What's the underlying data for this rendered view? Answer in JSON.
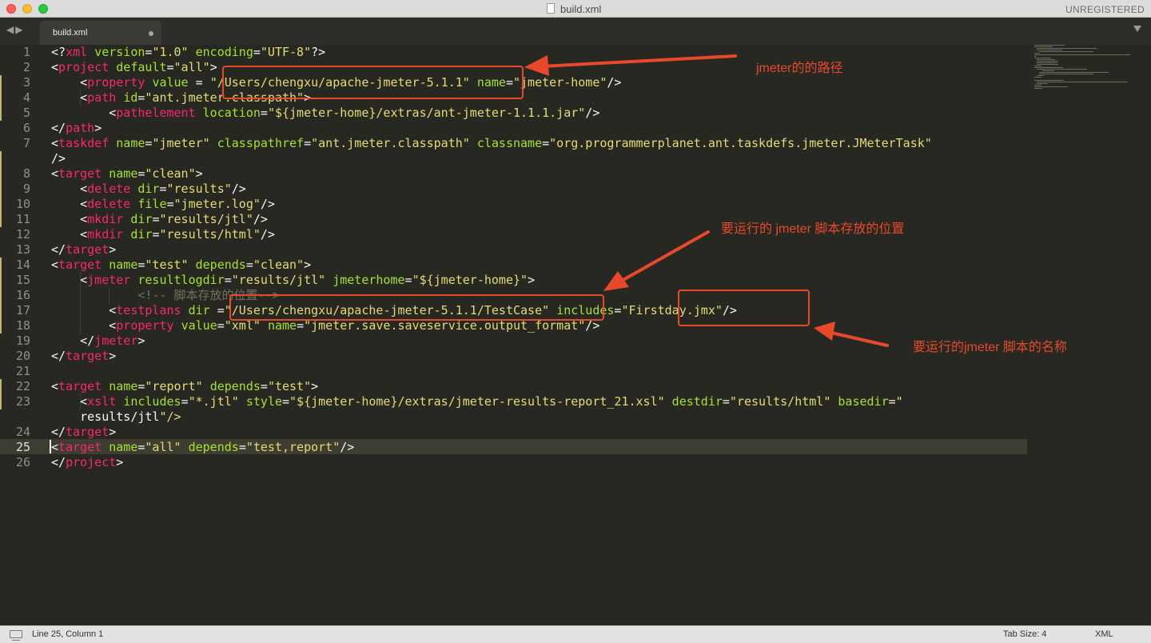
{
  "window": {
    "title": "build.xml",
    "registration": "UNREGISTERED"
  },
  "tabs": [
    {
      "label": "build.xml",
      "modified": true
    }
  ],
  "editor": {
    "line_numbers": [
      "1",
      "2",
      "3",
      "4",
      "5",
      "6",
      "7",
      "",
      "8",
      "9",
      "10",
      "11",
      "12",
      "13",
      "14",
      "15",
      "16",
      "17",
      "18",
      "19",
      "20",
      "21",
      "22",
      "23",
      "",
      "24",
      "25",
      "26"
    ],
    "current_line": "25",
    "lines": [
      "<?xml version=\"1.0\" encoding=\"UTF-8\"?>",
      "<project default=\"all\">",
      "    <property value = \"/Users/chengxu/apache-jmeter-5.1.1\" name=\"jmeter-home\"/>",
      "    <path id=\"ant.jmeter.classpath\">",
      "        <pathelement location=\"${jmeter-home}/extras/ant-jmeter-1.1.1.jar\"/>",
      "</path>",
      "<taskdef name=\"jmeter\" classpathref=\"ant.jmeter.classpath\" classname=\"org.programmerplanet.ant.taskdefs.jmeter.JMeterTask\"",
      "/>",
      "<target name=\"clean\">",
      "    <delete dir=\"results\"/>",
      "    <delete file=\"jmeter.log\"/>",
      "    <mkdir dir=\"results/jtl\"/>",
      "    <mkdir dir=\"results/html\"/>",
      "</target>",
      "<target name=\"test\" depends=\"clean\">",
      "    <jmeter resultlogdir=\"results/jtl\" jmeterhome=\"${jmeter-home}\">",
      "            <!-- 脚本存放的位置-->",
      "        <testplans dir =\"/Users/chengxu/apache-jmeter-5.1.1/TestCase\" includes=\"Firstday.jmx\"/>",
      "        <property value=\"xml\" name=\"jmeter.save.saveservice.output_format\"/>",
      "    </jmeter>",
      "</target>",
      "",
      "<target name=\"report\" depends=\"test\">",
      "    <xslt includes=\"*.jtl\" style=\"${jmeter-home}/extras/jmeter-results-report_21.xsl\" destdir=\"results/html\" basedir=\"",
      "    results/jtl\"/>",
      "</target>",
      "<target name=\"all\" depends=\"test,report\"/>",
      "</project>"
    ]
  },
  "annotations": {
    "jmeter_path": "jmeter的的路径",
    "script_location": "要运行的 jmeter 脚本存放的位置",
    "script_name": "要运行的jmeter 脚本的名称"
  },
  "statusbar": {
    "position": "Line 25, Column 1",
    "tab_size": "Tab Size: 4",
    "syntax": "XML"
  },
  "colors": {
    "background": "#272822",
    "tag": "#f92672",
    "attribute": "#a6e22e",
    "string": "#e6db74",
    "comment": "#75715e",
    "annotation": "#e8492b"
  }
}
